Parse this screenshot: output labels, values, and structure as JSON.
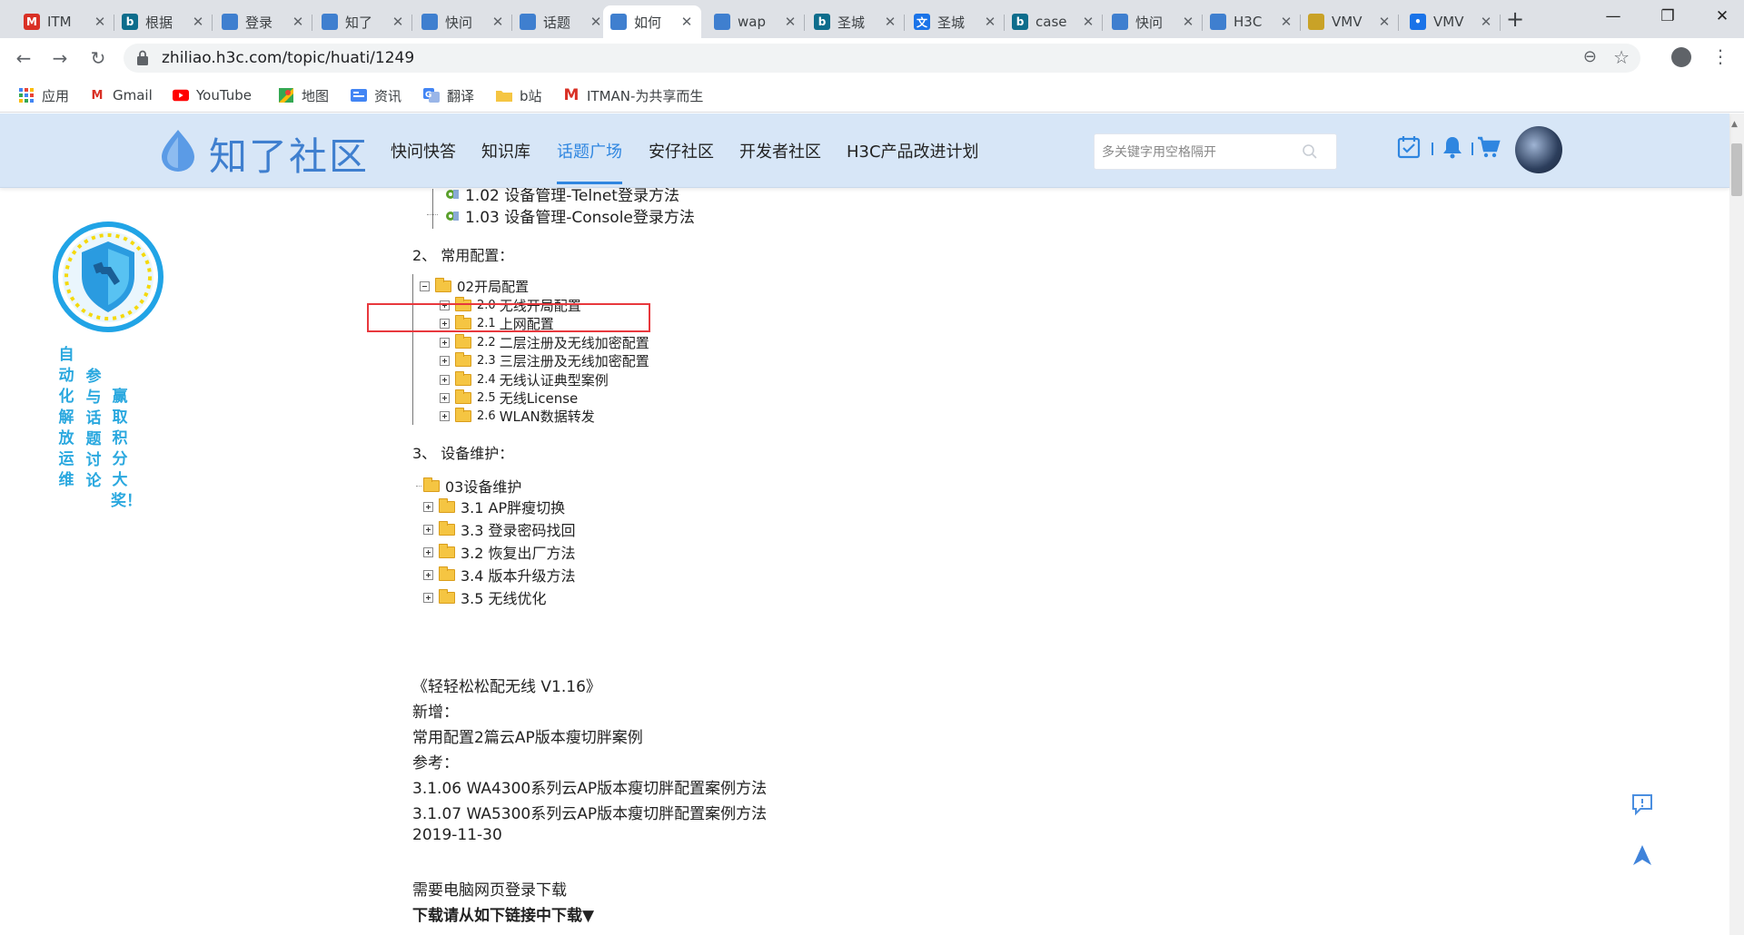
{
  "browser": {
    "tabs": [
      {
        "title": "ITM",
        "icon": "gmail-icon",
        "color": "#d93025",
        "glyph": "M"
      },
      {
        "title": "根据",
        "icon": "bing-icon",
        "color": "#0d6d8c",
        "glyph": "b"
      },
      {
        "title": "登录",
        "icon": "h3c-icon",
        "color": "#3f7fcf",
        "glyph": ""
      },
      {
        "title": "知了",
        "icon": "h3c-icon",
        "color": "#3f7fcf",
        "glyph": ""
      },
      {
        "title": "快问",
        "icon": "h3c-icon",
        "color": "#3f7fcf",
        "glyph": ""
      },
      {
        "title": "话题",
        "icon": "h3c-icon",
        "color": "#3f7fcf",
        "glyph": ""
      },
      {
        "title": "如何",
        "icon": "h3c-icon",
        "color": "#3f7fcf",
        "glyph": "",
        "active": true
      },
      {
        "title": "wap",
        "icon": "h3c-icon",
        "color": "#3f7fcf",
        "glyph": ""
      },
      {
        "title": "圣城",
        "icon": "bing-icon",
        "color": "#0d6d8c",
        "glyph": "b"
      },
      {
        "title": "圣城",
        "icon": "translate-icon",
        "color": "#1a73e8",
        "glyph": "文"
      },
      {
        "title": "case",
        "icon": "bing-icon",
        "color": "#0d6d8c",
        "glyph": "b"
      },
      {
        "title": "快问",
        "icon": "h3c-icon",
        "color": "#3f7fcf",
        "glyph": ""
      },
      {
        "title": "H3C",
        "icon": "h3c-icon",
        "color": "#3f7fcf",
        "glyph": ""
      },
      {
        "title": "VMV",
        "icon": "vm-icon",
        "color": "#c9a227",
        "glyph": ""
      },
      {
        "title": "VMV",
        "icon": "dot-icon",
        "color": "#1a73e8",
        "glyph": "•"
      }
    ],
    "url": "zhiliao.h3c.com/topic/huati/1249",
    "bookmarks": [
      {
        "label": "应用",
        "icon": "apps-icon"
      },
      {
        "label": "Gmail",
        "icon": "gmail-icon"
      },
      {
        "label": "YouTube",
        "icon": "youtube-icon"
      },
      {
        "label": "地图",
        "icon": "maps-icon"
      },
      {
        "label": "资讯",
        "icon": "news-icon"
      },
      {
        "label": "翻译",
        "icon": "translate-icon"
      },
      {
        "label": "b站",
        "icon": "folder-icon"
      },
      {
        "label": "ITMAN-为共享而生",
        "icon": "itman-icon"
      }
    ]
  },
  "site": {
    "logo_text": "知了社区",
    "nav": [
      {
        "label": "快问快答",
        "active": false
      },
      {
        "label": "知识库",
        "active": false
      },
      {
        "label": "话题广场",
        "active": true
      },
      {
        "label": "安仔社区",
        "active": false
      },
      {
        "label": "开发者社区",
        "active": false
      },
      {
        "label": "H3C产品改进计划",
        "active": false
      }
    ],
    "search_placeholder": "多关键字用空格隔开"
  },
  "promo": {
    "col1": "自动化解放运维",
    "col2": "参与话题讨论",
    "col3": "赢取积分大奖！"
  },
  "tree": {
    "top_items": [
      "1.02 设备管理-Telnet登录方法",
      "1.03 设备管理-Console登录方法"
    ],
    "section2": "2、  常用配置：",
    "folder2": "02开局配置",
    "folder2_children": [
      {
        "num": "2.0",
        "label": "无线开局配置"
      },
      {
        "num": "2.1",
        "label": "上网配置"
      },
      {
        "num": "2.2",
        "label": "二层注册及无线加密配置"
      },
      {
        "num": "2.3",
        "label": "三层注册及无线加密配置"
      },
      {
        "num": "2.4",
        "label": "无线认证典型案例"
      },
      {
        "num": "2.5",
        "label": "无线License"
      },
      {
        "num": "2.6",
        "label": "WLAN数据转发"
      }
    ],
    "section3": "3、  设备维护：",
    "folder3": "03设备维护",
    "folder3_children": [
      "3.1 AP胖瘦切换",
      "3.3 登录密码找回",
      "3.2 恢复出厂方法",
      "3.4 版本升级方法",
      "3.5 无线优化"
    ]
  },
  "notes": {
    "l1": "《轻轻松松配无线 V1.16》",
    "l2": "新增：",
    "l3": "常用配置2篇云AP版本瘦切胖案例",
    "l4": "参考：",
    "l5": "3.1.06 WA4300系列云AP版本瘦切胖配置案例方法",
    "l6": "3.1.07 WA5300系列云AP版本瘦切胖配置案例方法",
    "l7": "2019-11-30",
    "l8": "需要电脑网页登录下载",
    "l9": "下载请从如下链接中下载▼"
  }
}
